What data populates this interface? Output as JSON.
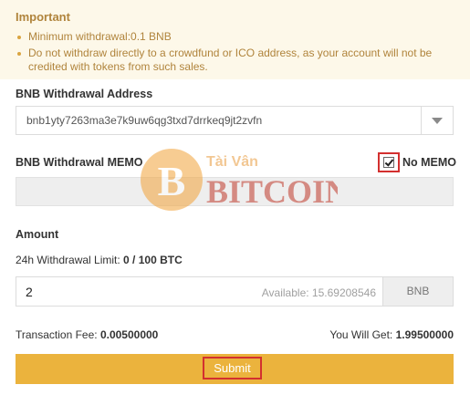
{
  "notice": {
    "title": "Important",
    "items": [
      "Minimum withdrawal:0.1 BNB",
      "Do not withdraw directly to a crowdfund or ICO address, as your account will not be credited with tokens from such sales."
    ]
  },
  "address": {
    "label": "BNB Withdrawal Address",
    "value": "bnb1yty7263ma3e7k9uw6qg3txd7drrkeq9jt2zvfn"
  },
  "memo": {
    "label": "BNB Withdrawal MEMO",
    "no_memo_label": "No MEMO",
    "no_memo_checked": true
  },
  "amount": {
    "label": "Amount",
    "limit_prefix": "24h Withdrawal Limit: ",
    "limit_value": "0 / 100 BTC",
    "value": "2",
    "available": "Available: 15.69208546",
    "unit": "BNB"
  },
  "summary": {
    "fee_label": "Transaction Fee: ",
    "fee_value": "0.00500000",
    "get_label": "You Will Get: ",
    "get_value": "1.99500000"
  },
  "submit": {
    "label": "Submit"
  },
  "watermark": {
    "text": "BITCOIN",
    "sub": "Tài Vân"
  },
  "colors": {
    "accent": "#ebb33d",
    "highlight": "#d3302f",
    "notice_text": "#b0843c"
  },
  "icons": {
    "dropdown": "caret-down-icon",
    "checkbox": "checkmark-icon"
  }
}
